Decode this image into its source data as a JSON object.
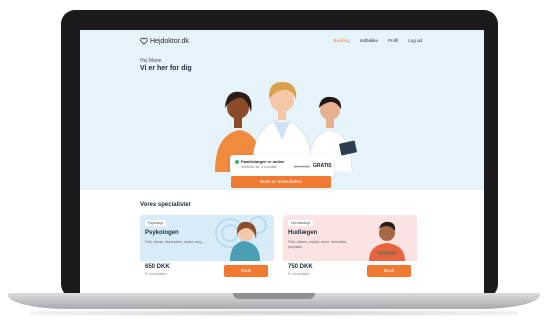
{
  "brand": {
    "name": "Hejdoktor.dk",
    "accent": "#f07a32",
    "hero_bg": "#e6f3fb"
  },
  "nav": {
    "items": [
      {
        "label": "Booking",
        "active": true
      },
      {
        "label": "Indbakke",
        "active": false
      },
      {
        "label": "Profil",
        "active": false
      },
      {
        "label": "Log ud",
        "active": false
      }
    ]
  },
  "hero": {
    "greeting": "Hej Marie",
    "headline": "Vi er her for dig",
    "status": "Familielægen er online",
    "wait": "Ventetid: ca. 5 minutter",
    "old_price": "219 DKK",
    "price": "GRATIS",
    "cta": "Book en konsultation"
  },
  "specialists": {
    "title": "Vores specialister",
    "cards": [
      {
        "tag": "Psykologi",
        "title": "Psykologen",
        "desc": "Fobi, stress, depression, angst, sorg, ...",
        "price": "650 DKK",
        "price_sub": "Pr. konsultation",
        "button": "Book"
      },
      {
        "tag": "Dermatologi",
        "title": "Hudlægen",
        "desc": "Fobi, eksem, uddyld, arme, dermatisk, psoriasis",
        "price": "750 DKK",
        "price_sub": "Pr. konsultation",
        "button": "Book"
      }
    ]
  }
}
